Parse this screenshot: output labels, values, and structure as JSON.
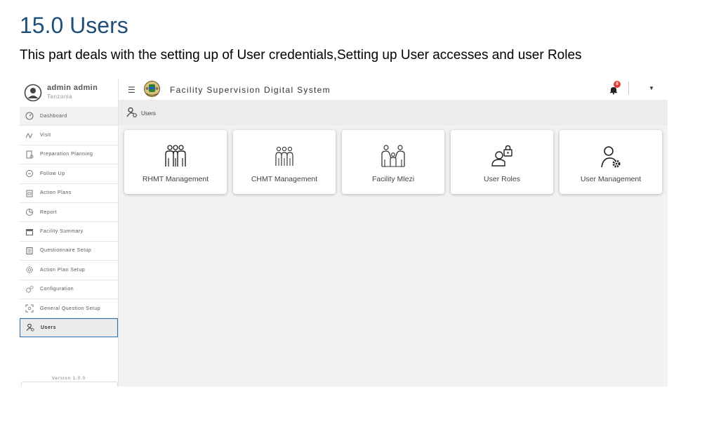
{
  "document": {
    "heading": "15.0 Users",
    "intro": "This part deals with the setting up of User credentials,Setting up User accesses and user Roles"
  },
  "profile": {
    "name": "admin admin",
    "region": "Tanzania"
  },
  "header": {
    "title": "Facility Supervision Digital System",
    "notification_count": "8"
  },
  "sidebar": {
    "items": [
      {
        "label": "Dashboard",
        "icon": "gauge-icon"
      },
      {
        "label": "Visit",
        "icon": "route-icon"
      },
      {
        "label": "Preparation Planning",
        "icon": "document-icon"
      },
      {
        "label": "Follow Up",
        "icon": "clock-icon"
      },
      {
        "label": "Action Plans",
        "icon": "clipboard-icon"
      },
      {
        "label": "Report",
        "icon": "pie-chart-icon"
      },
      {
        "label": "Facility Summary",
        "icon": "calendar-icon"
      },
      {
        "label": "Questionnaire Setup",
        "icon": "list-icon"
      },
      {
        "label": "Action Plan Setup",
        "icon": "gear-icon"
      },
      {
        "label": "Configuration",
        "icon": "gears-icon"
      },
      {
        "label": "General Question Setup",
        "icon": "scan-icon"
      },
      {
        "label": "Users",
        "icon": "user-gear-icon"
      }
    ],
    "active": "Users",
    "version": "Version 1.0.0"
  },
  "breadcrumb": {
    "label": "Users"
  },
  "cards": [
    {
      "label": "RHMT Management",
      "icon": "group-icon"
    },
    {
      "label": "CHMT Management",
      "icon": "team-icon"
    },
    {
      "label": "Facility Mlezi",
      "icon": "family-icon"
    },
    {
      "label": "User Roles",
      "icon": "user-lock-icon"
    },
    {
      "label": "User Management",
      "icon": "user-gear-icon"
    }
  ]
}
